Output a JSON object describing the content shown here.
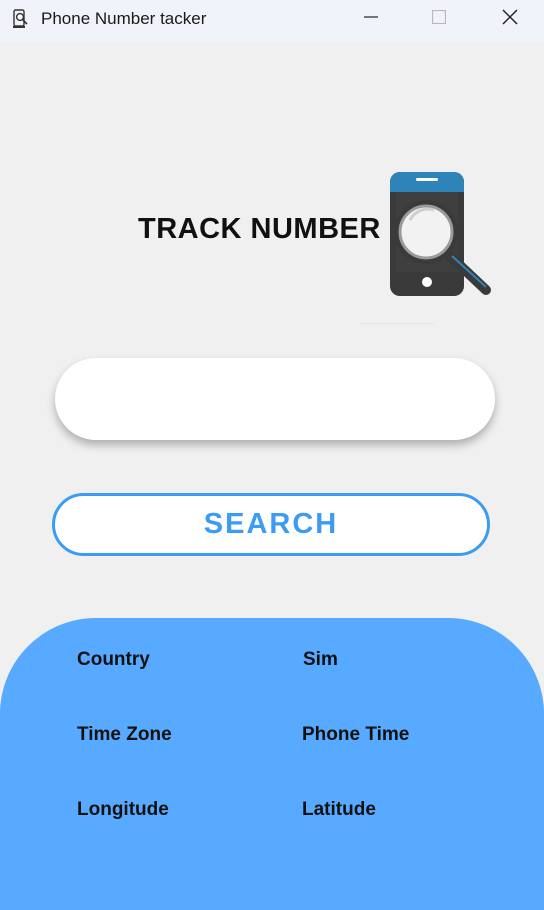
{
  "window": {
    "title": "Phone Number tacker",
    "icons": [
      "phone-search-app-icon",
      "minimize-icon",
      "maximize-icon",
      "close-icon"
    ]
  },
  "header": {
    "logo_text": "TRACK NUMBER",
    "logo_icon": "phone-magnifier-icon"
  },
  "search": {
    "input_value": "",
    "input_placeholder": "",
    "button_label": "SEARCH"
  },
  "results": {
    "country_label": "Country",
    "sim_label": "Sim",
    "timezone_label": "Time Zone",
    "phone_time_label": "Phone Time",
    "longitude_label": "Longitude",
    "latitude_label": "Latitude"
  },
  "colors": {
    "accent": "#3b9bf5",
    "panel": "#57aaff",
    "background": "#f0f0f0"
  }
}
